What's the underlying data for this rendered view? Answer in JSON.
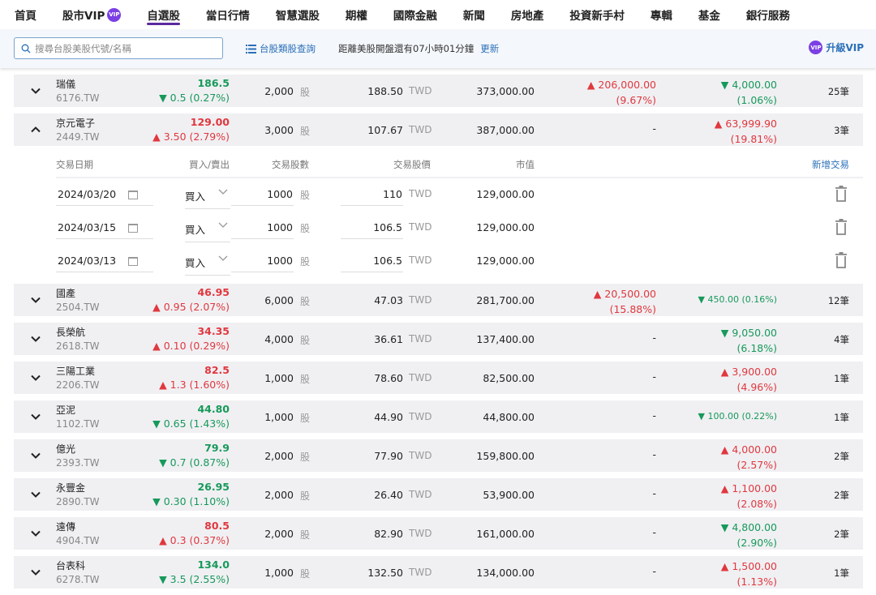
{
  "nav": [
    "首頁",
    "股市VIP",
    "自選股",
    "當日行情",
    "智慧選股",
    "期權",
    "國際金融",
    "新聞",
    "房地產",
    "投資新手村",
    "專輯",
    "基金",
    "銀行服務"
  ],
  "nav_active": 2,
  "vip_badge": "VIP",
  "toolbar": {
    "search_placeholder": "搜尋台股美股代號/名稱",
    "category_link": "台股類股查詢",
    "countdown": "距離美股開盤還有07小時01分鐘",
    "refresh": "更新",
    "upgrade": "升級VIP"
  },
  "colors": {
    "up": "#e0383e",
    "down": "#17995a",
    "accent": "#2a6fb8",
    "vip": "#7b3fe4"
  },
  "unit_shares": "股",
  "currency": "TWD",
  "stocks": [
    {
      "name": "瑞儀",
      "code": "6176.TW",
      "price": "186.5",
      "dir": "down",
      "change": "0.5 (0.27%)",
      "shares": "2,000",
      "cost": "188.50",
      "mv": "373,000.00",
      "pl1": {
        "dir": "up",
        "value": "206,000.00",
        "pct": "(9.67%)"
      },
      "pl2": {
        "dir": "down",
        "value": "4,000.00",
        "pct": "(1.06%)"
      },
      "count": "25筆",
      "expanded": false
    },
    {
      "name": "京元電子",
      "code": "2449.TW",
      "price": "129.00",
      "dir": "up",
      "change": "3.50 (2.79%)",
      "shares": "3,000",
      "cost": "107.67",
      "mv": "387,000.00",
      "pl1": "-",
      "pl2": {
        "dir": "up",
        "value": "63,999.90",
        "pct": "(19.81%)"
      },
      "count": "3筆",
      "expanded": true
    },
    {
      "name": "國產",
      "code": "2504.TW",
      "price": "46.95",
      "dir": "up",
      "change": "0.95 (2.07%)",
      "shares": "6,000",
      "cost": "47.03",
      "mv": "281,700.00",
      "pl1": {
        "dir": "up",
        "value": "20,500.00",
        "pct": "(15.88%)"
      },
      "pl2": {
        "dir": "down",
        "value": "450.00",
        "pct": "(0.16%)",
        "inline": true
      },
      "count": "12筆",
      "expanded": false
    },
    {
      "name": "長榮航",
      "code": "2618.TW",
      "price": "34.35",
      "dir": "up",
      "change": "0.10 (0.29%)",
      "shares": "4,000",
      "cost": "36.61",
      "mv": "137,400.00",
      "pl1": "-",
      "pl2": {
        "dir": "down",
        "value": "9,050.00",
        "pct": "(6.18%)"
      },
      "count": "4筆",
      "expanded": false
    },
    {
      "name": "三陽工業",
      "code": "2206.TW",
      "price": "82.5",
      "dir": "up",
      "change": "1.3 (1.60%)",
      "shares": "1,000",
      "cost": "78.60",
      "mv": "82,500.00",
      "pl1": "-",
      "pl2": {
        "dir": "up",
        "value": "3,900.00",
        "pct": "(4.96%)"
      },
      "count": "1筆",
      "expanded": false
    },
    {
      "name": "亞泥",
      "code": "1102.TW",
      "price": "44.80",
      "dir": "down",
      "change": "0.65 (1.43%)",
      "shares": "1,000",
      "cost": "44.90",
      "mv": "44,800.00",
      "pl1": "-",
      "pl2": {
        "dir": "down",
        "value": "100.00",
        "pct": "(0.22%)",
        "inline": true
      },
      "count": "1筆",
      "expanded": false
    },
    {
      "name": "億光",
      "code": "2393.TW",
      "price": "79.9",
      "dir": "down",
      "change": "0.7 (0.87%)",
      "shares": "2,000",
      "cost": "77.90",
      "mv": "159,800.00",
      "pl1": "-",
      "pl2": {
        "dir": "up",
        "value": "4,000.00",
        "pct": "(2.57%)"
      },
      "count": "2筆",
      "expanded": false
    },
    {
      "name": "永豐金",
      "code": "2890.TW",
      "price": "26.95",
      "dir": "down",
      "change": "0.30 (1.10%)",
      "shares": "2,000",
      "cost": "26.40",
      "mv": "53,900.00",
      "pl1": "-",
      "pl2": {
        "dir": "up",
        "value": "1,100.00",
        "pct": "(2.08%)"
      },
      "count": "2筆",
      "expanded": false
    },
    {
      "name": "遠傳",
      "code": "4904.TW",
      "price": "80.5",
      "dir": "up",
      "change": "0.3 (0.37%)",
      "shares": "2,000",
      "cost": "82.90",
      "mv": "161,000.00",
      "pl1": "-",
      "pl2": {
        "dir": "down",
        "value": "4,800.00",
        "pct": "(2.90%)"
      },
      "count": "2筆",
      "expanded": false
    },
    {
      "name": "台表科",
      "code": "6278.TW",
      "price": "134.0",
      "dir": "down",
      "change": "3.5 (2.55%)",
      "shares": "1,000",
      "cost": "132.50",
      "mv": "134,000.00",
      "pl1": "-",
      "pl2": {
        "dir": "up",
        "value": "1,500.00",
        "pct": "(1.13%)"
      },
      "count": "1筆",
      "expanded": false
    }
  ],
  "detail": {
    "headers": [
      "交易日期",
      "買入/賣出",
      "交易股數",
      "交易股價",
      "市值"
    ],
    "add_label": "新增交易",
    "trades": [
      {
        "date": "2024/03/20",
        "side": "買入",
        "qty": "1000",
        "price": "110",
        "mv": "129,000.00"
      },
      {
        "date": "2024/03/15",
        "side": "買入",
        "qty": "1000",
        "price": "106.5",
        "mv": "129,000.00"
      },
      {
        "date": "2024/03/13",
        "side": "買入",
        "qty": "1000",
        "price": "106.5",
        "mv": "129,000.00"
      }
    ]
  }
}
